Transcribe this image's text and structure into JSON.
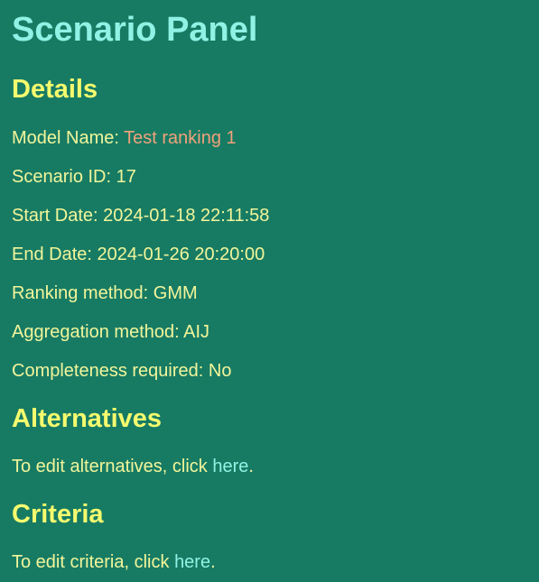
{
  "page": {
    "title": "Scenario Panel"
  },
  "details": {
    "heading": "Details",
    "model_name_label": "Model Name: ",
    "model_name_value": "Test ranking 1",
    "scenario_id_label": "Scenario ID: ",
    "scenario_id_value": "17",
    "start_date_label": "Start Date: ",
    "start_date_value": "2024-01-18 22:11:58",
    "end_date_label": "End Date: ",
    "end_date_value": "2024-01-26 20:20:00",
    "ranking_method_label": "Ranking method: ",
    "ranking_method_value": "GMM",
    "aggregation_method_label": "Aggregation method: ",
    "aggregation_method_value": "AIJ",
    "completeness_label": "Completeness required: ",
    "completeness_value": "No"
  },
  "alternatives": {
    "heading": "Alternatives",
    "text_before": "To edit alternatives, click ",
    "link_label": "here",
    "text_after": "."
  },
  "criteria": {
    "heading": "Criteria",
    "text_before": "To edit criteria, click ",
    "link_label": "here",
    "text_after": "."
  },
  "colors": {
    "background": "#177b64",
    "title": "#8ff2e4",
    "heading": "#f5fb6e",
    "text": "#f2f59a",
    "accent": "#f0a27a",
    "link": "#8ff2e4"
  }
}
